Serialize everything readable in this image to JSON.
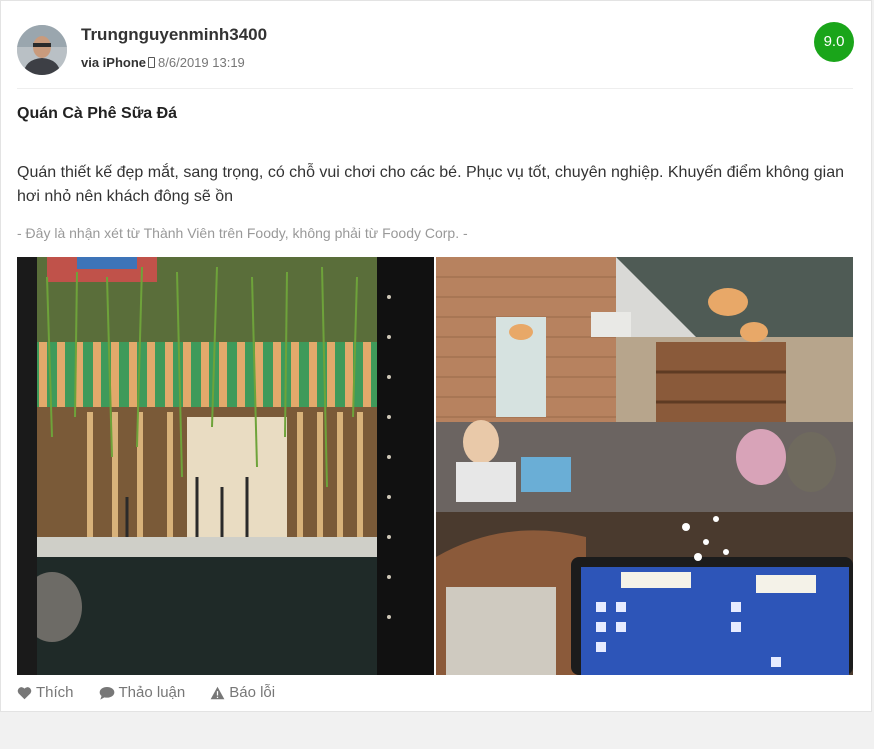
{
  "review": {
    "username": "Trungnguyenminh3400",
    "via_label": "via iPhone",
    "date": "8/6/2019 13:19",
    "score": "9.0",
    "title": "Quán Cà Phê Sữa Đá",
    "body": "Quán thiết kế đẹp mắt, sang trọng, có chỗ vui chơi cho các bé. Phục vụ tốt, chuyên nghiệp. Khuyến điểm không gian hơi nhỏ nên khách đông sẽ ồn",
    "disclaimer": "- Đây là nhận xét từ Thành Viên trên Foody, không phải từ Foody Corp. -"
  },
  "actions": {
    "like_label": "Thích",
    "discuss_label": "Thảo luận",
    "report_label": "Báo lỗi"
  },
  "icons": {
    "like": "heart-icon",
    "discuss": "chat-bubble-icon",
    "report": "warning-icon",
    "device": "phone-icon"
  },
  "colors": {
    "score_badge": "#1aa51a",
    "muted_text": "#999999"
  }
}
